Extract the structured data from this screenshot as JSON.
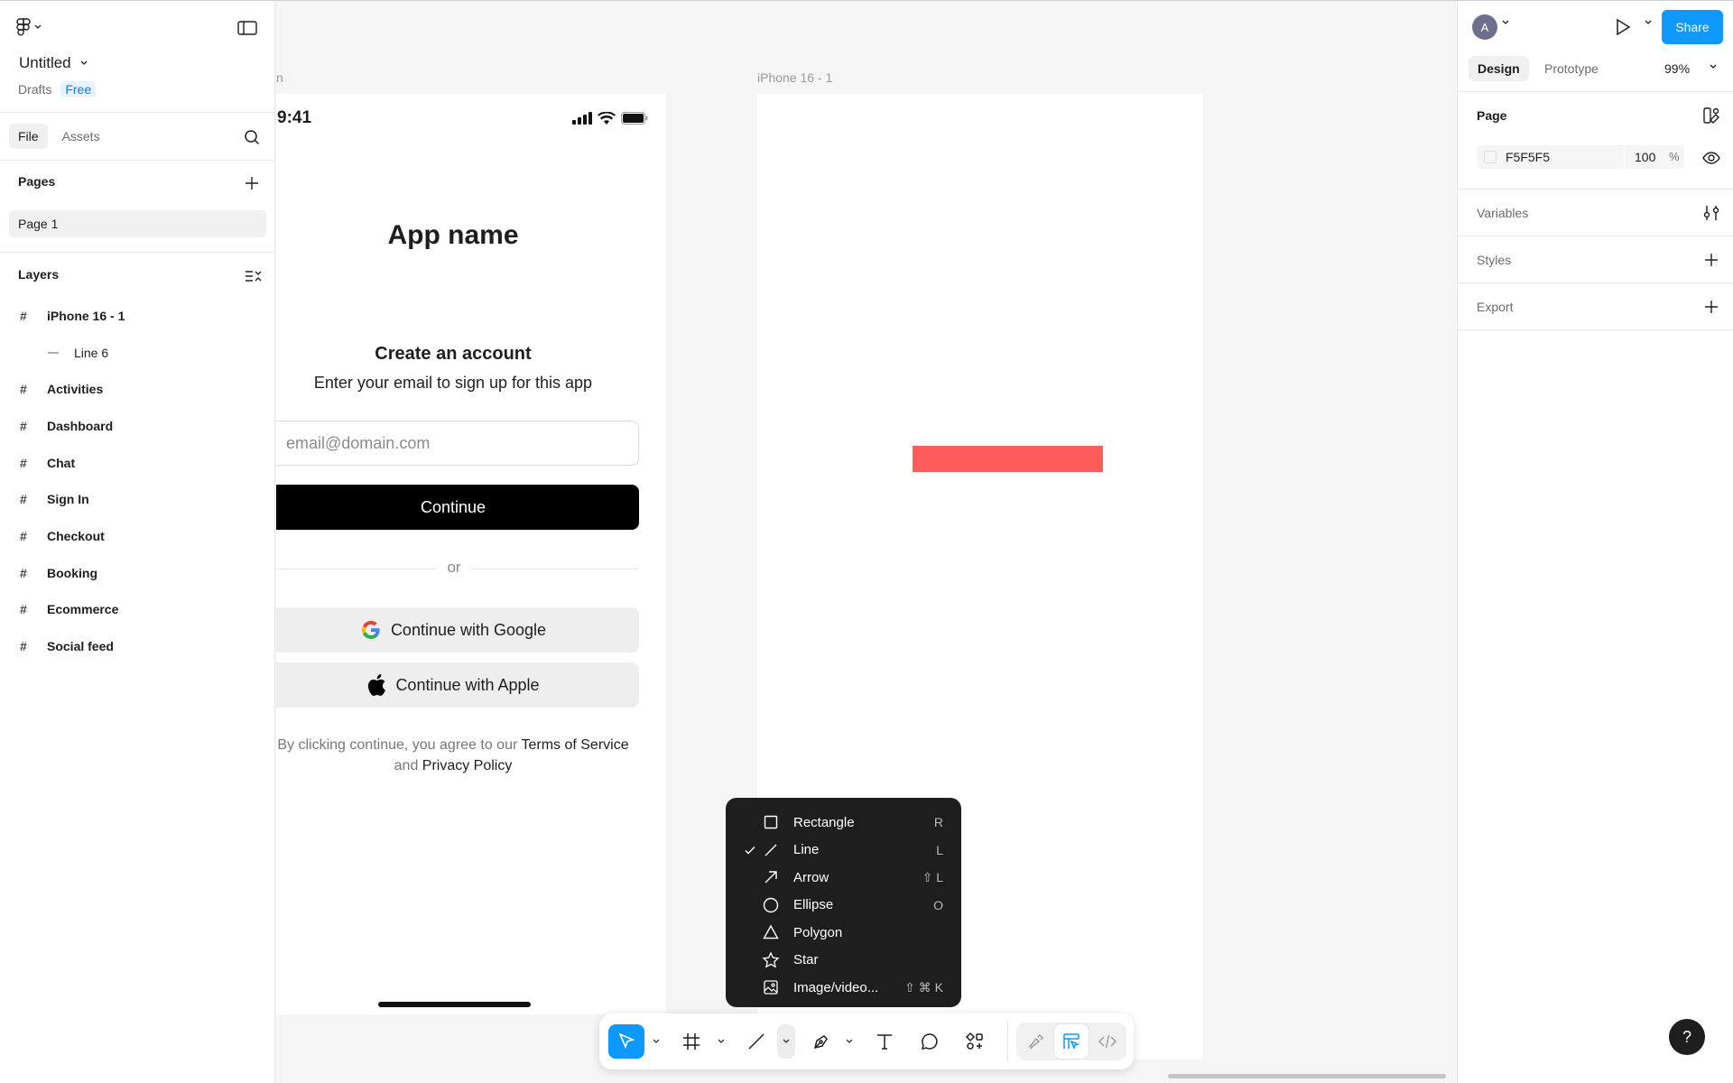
{
  "file": {
    "title": "Untitled",
    "location": "Drafts",
    "plan_badge": "Free"
  },
  "left_panel": {
    "tabs": [
      {
        "label": "File",
        "active": true
      },
      {
        "label": "Assets",
        "active": false
      }
    ],
    "pages_header": "Pages",
    "pages": [
      "Page 1"
    ],
    "layers_header": "Layers",
    "layers": [
      {
        "label": "iPhone 16 - 1",
        "icon": "frame-icon"
      },
      {
        "label": "Line 6",
        "icon": "line-icon",
        "child": true
      },
      {
        "label": "Activities",
        "icon": "frame-icon"
      },
      {
        "label": "Dashboard",
        "icon": "frame-icon"
      },
      {
        "label": "Chat",
        "icon": "frame-icon"
      },
      {
        "label": "Sign In",
        "icon": "frame-icon"
      },
      {
        "label": "Checkout",
        "icon": "frame-icon"
      },
      {
        "label": "Booking",
        "icon": "frame-icon"
      },
      {
        "label": "Ecommerce",
        "icon": "frame-icon"
      },
      {
        "label": "Social feed",
        "icon": "frame-icon"
      }
    ]
  },
  "canvas": {
    "partial_frame_label": "n",
    "frame_label": "iPhone 16 - 1",
    "rect_color": "#ff5c5c",
    "signin_frame": {
      "status_time": "9:41",
      "app_name": "App name",
      "heading": "Create an account",
      "subheading": "Enter your email to sign up for this app",
      "email_placeholder": "email@domain.com",
      "continue_label": "Continue",
      "divider_text": "or",
      "google_label": "Continue with Google",
      "apple_label": "Continue with Apple",
      "terms_prefix": "By clicking continue, you agree to our ",
      "terms_link": "Terms of Service",
      "terms_and": "and ",
      "privacy_link": "Privacy Policy"
    }
  },
  "shape_menu": {
    "items": [
      {
        "label": "Rectangle",
        "shortcut": "R",
        "icon": "rectangle-icon",
        "checked": false
      },
      {
        "label": "Line",
        "shortcut": "L",
        "icon": "line-icon",
        "checked": true
      },
      {
        "label": "Arrow",
        "shortcut": "⇧ L",
        "icon": "arrow-icon",
        "checked": false
      },
      {
        "label": "Ellipse",
        "shortcut": "O",
        "icon": "ellipse-icon",
        "checked": false
      },
      {
        "label": "Polygon",
        "shortcut": "",
        "icon": "polygon-icon",
        "checked": false
      },
      {
        "label": "Star",
        "shortcut": "",
        "icon": "star-icon",
        "checked": false
      },
      {
        "label": "Image/video...",
        "shortcut": "⇧ ⌘ K",
        "icon": "image-icon",
        "checked": false
      }
    ]
  },
  "toolbar": {
    "tools": [
      "move-tool",
      "frame-tool",
      "line-tool",
      "pen-tool",
      "text-tool",
      "comment-tool",
      "actions-tool",
      "draw-mode",
      "design-mode",
      "dev-mode"
    ],
    "accent": "#0d99ff"
  },
  "right_panel": {
    "avatar_initial": "A",
    "share_label": "Share",
    "tabs": [
      {
        "label": "Design",
        "active": true
      },
      {
        "label": "Prototype",
        "active": false
      }
    ],
    "zoom": "99%",
    "page_header": "Page",
    "page_color": "F5F5F5",
    "page_opacity": "100",
    "page_opacity_unit": "%",
    "variables_header": "Variables",
    "styles_header": "Styles",
    "export_header": "Export"
  },
  "help_label": "?"
}
